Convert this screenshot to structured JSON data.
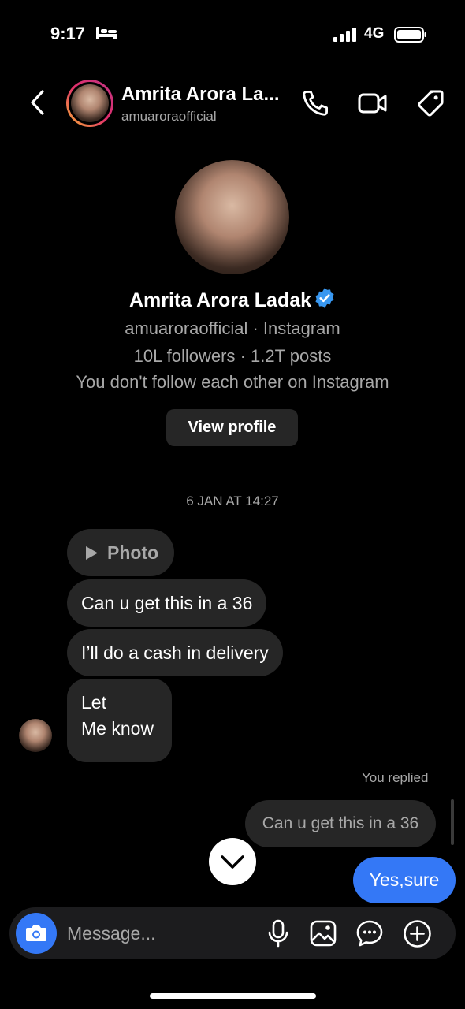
{
  "status_bar": {
    "time": "9:17",
    "network": "4G"
  },
  "header": {
    "title": "Amrita Arora La...",
    "username": "amuaroraofficial"
  },
  "profile": {
    "name": "Amrita Arora Ladak",
    "handle_line": "amuaroraofficial · Instagram",
    "stats_line": "10L followers · 1.2T posts",
    "follow_line": "You don't follow each other on Instagram",
    "view_profile_label": "View profile"
  },
  "thread": {
    "timestamp": "6 JAN AT 14:27",
    "messages": [
      {
        "type": "photo",
        "text": "Photo"
      },
      {
        "type": "text",
        "text": "Can u get this in a 36"
      },
      {
        "type": "text",
        "text": "I’ll do a cash in delivery"
      },
      {
        "type": "text",
        "line1": "Let",
        "line2": "Me know"
      }
    ],
    "reply_label": "You replied",
    "reply_quote": "Can u get this in a 36",
    "sent_message": "Yes,sure"
  },
  "composer": {
    "placeholder": "Message..."
  },
  "colors": {
    "accent": "#3478f6",
    "bubble": "#262626",
    "background": "#000000",
    "muted_text": "#a8a8a8"
  },
  "icons": [
    "bed-icon",
    "signal-icon",
    "battery-icon",
    "back-icon",
    "call-icon",
    "video-icon",
    "tag-icon",
    "verified-icon",
    "play-icon",
    "chevron-down-icon",
    "camera-icon",
    "microphone-icon",
    "gallery-icon",
    "sticker-icon",
    "plus-icon"
  ]
}
